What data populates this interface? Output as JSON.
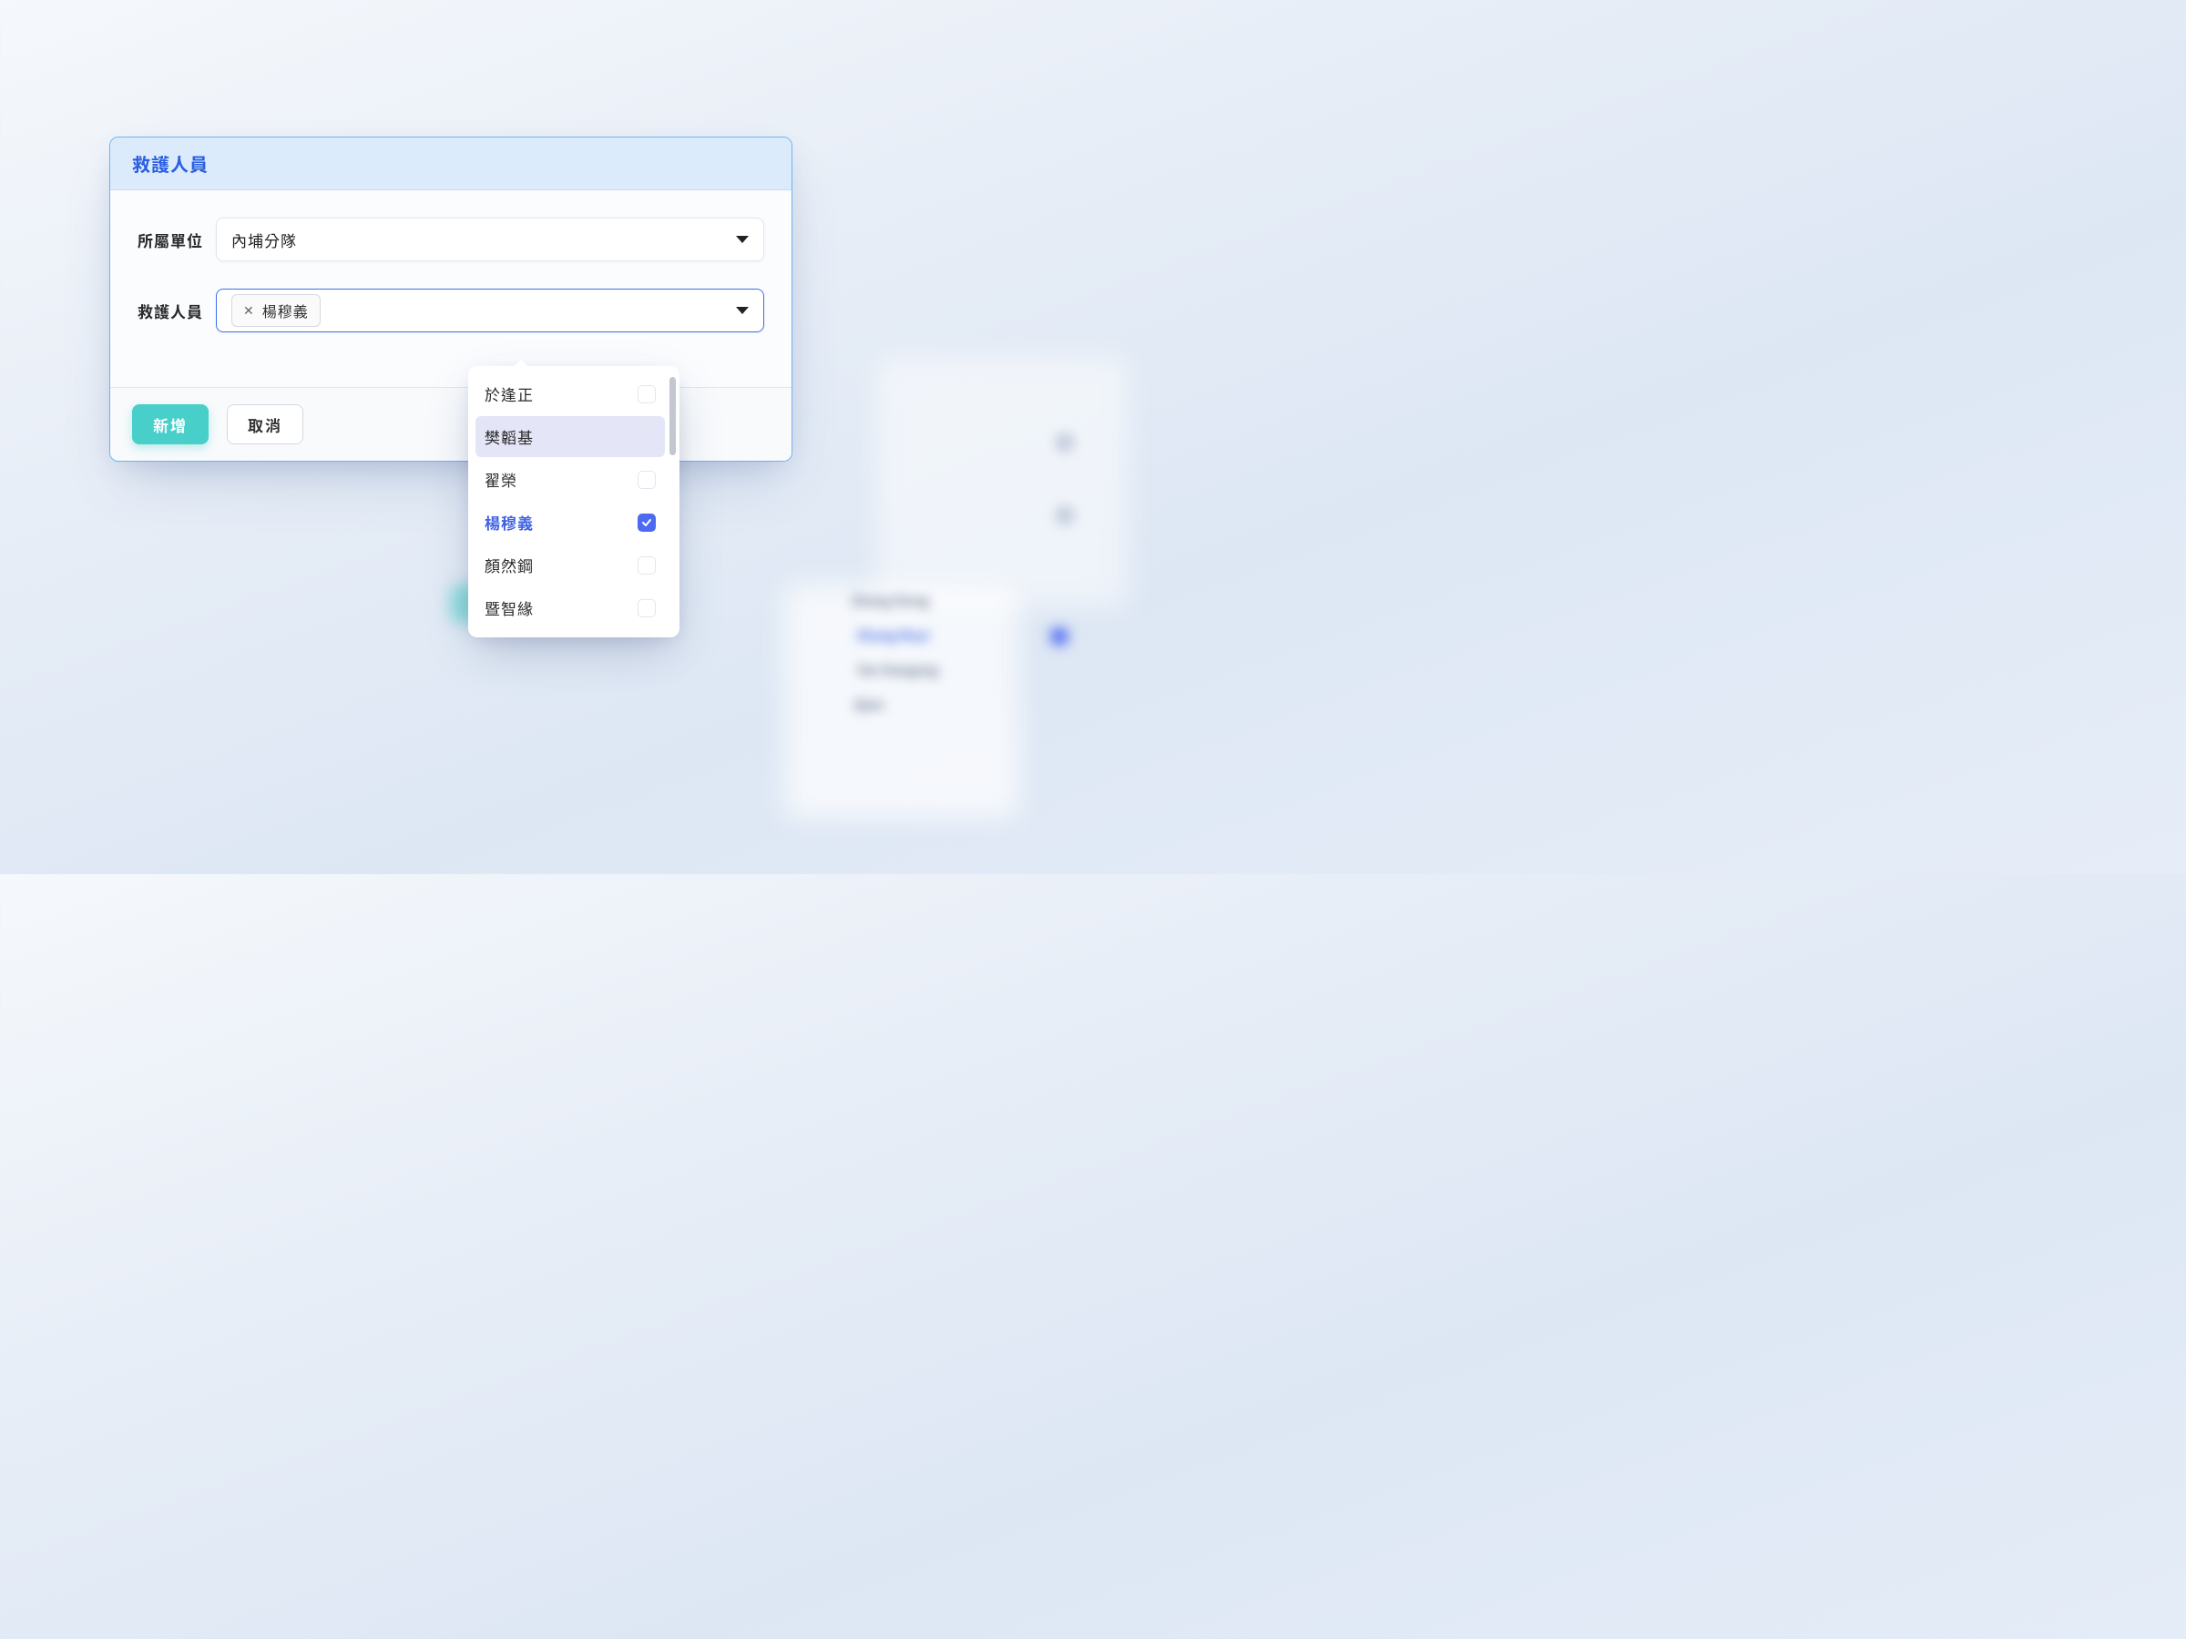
{
  "modal": {
    "title": "救護人員",
    "fields": {
      "unit": {
        "label": "所屬單位",
        "value": "內埔分隊"
      },
      "personnel": {
        "label": "救護人員",
        "chip": "楊穆義"
      }
    },
    "dropdown": {
      "items": [
        {
          "label": "於逢正",
          "selected": false,
          "hover": false
        },
        {
          "label": "樊韜基",
          "selected": false,
          "hover": true
        },
        {
          "label": "翟榮",
          "selected": false,
          "hover": false
        },
        {
          "label": "楊穆義",
          "selected": true,
          "hover": false
        },
        {
          "label": "顏然鋼",
          "selected": false,
          "hover": false
        },
        {
          "label": "暨智緣",
          "selected": false,
          "hover": false
        }
      ]
    },
    "actions": {
      "add": "新增",
      "cancel": "取消"
    }
  }
}
